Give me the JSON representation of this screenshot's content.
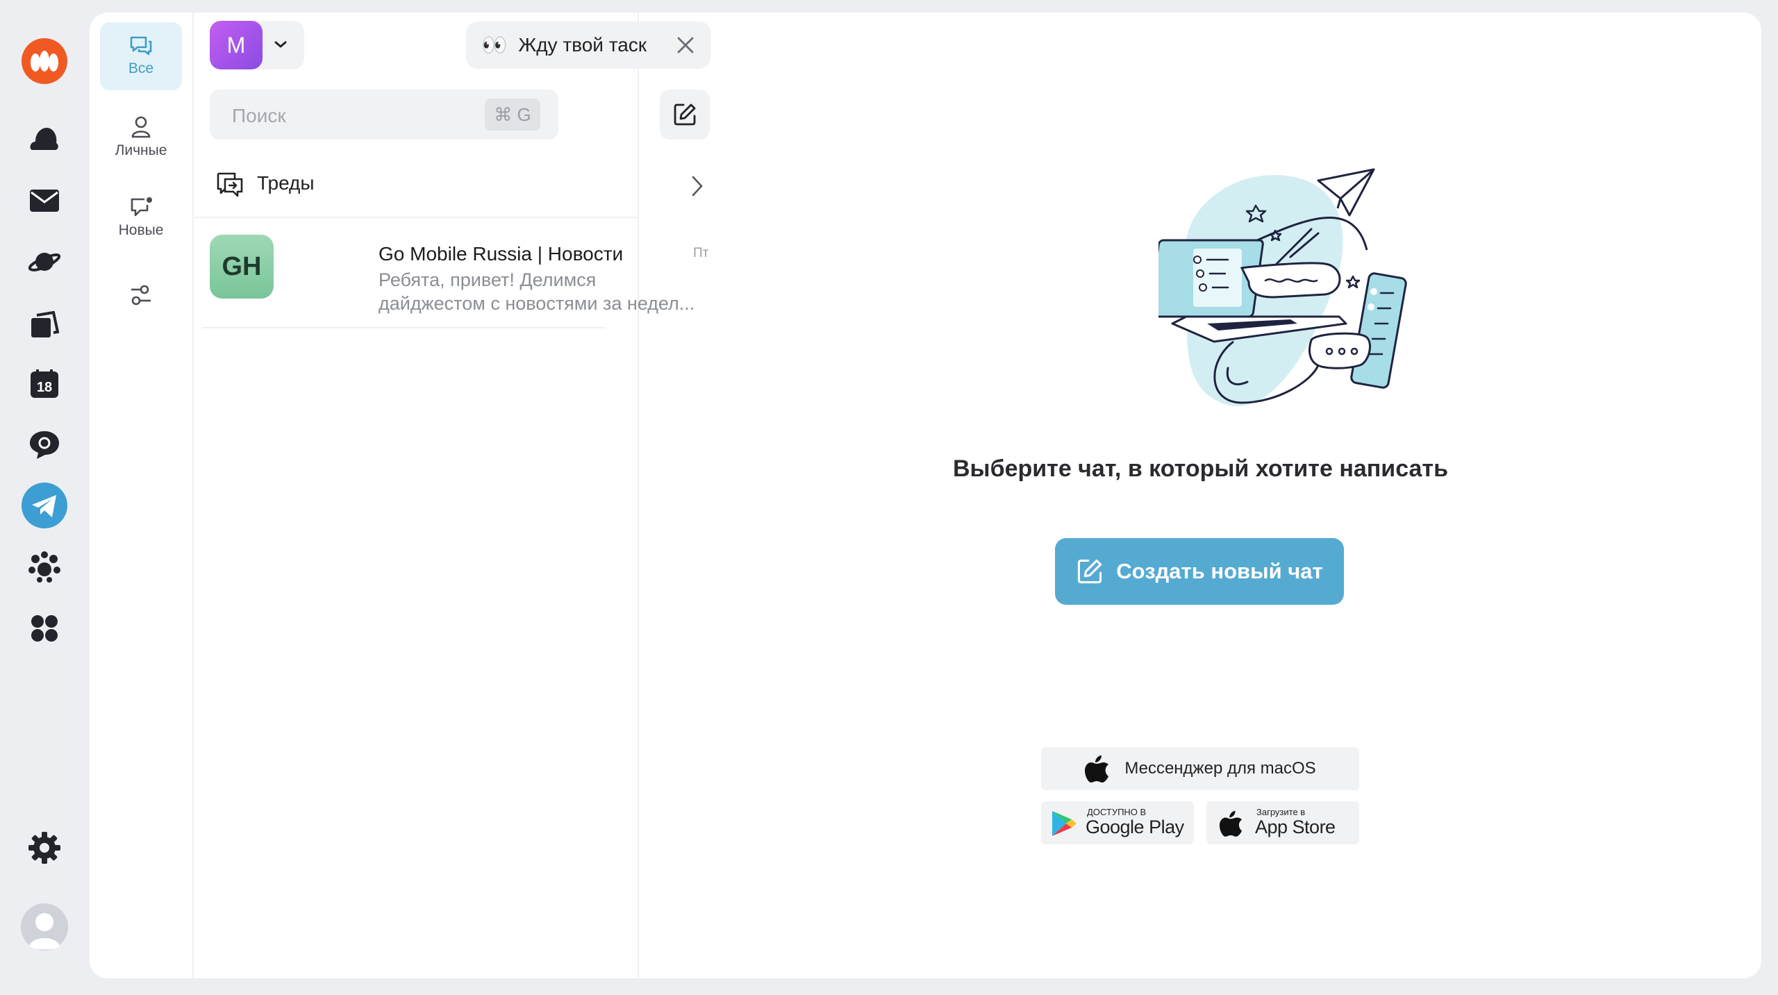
{
  "rail": {
    "items": [
      {
        "name": "messenger-logo-icon"
      },
      {
        "name": "cloud-icon"
      },
      {
        "name": "mail-icon"
      },
      {
        "name": "saturn-icon"
      },
      {
        "name": "cards-icon"
      },
      {
        "name": "calendar-icon",
        "text": "18"
      },
      {
        "name": "chat-bubble-icon"
      },
      {
        "name": "telegram-icon"
      },
      {
        "name": "pets-icon"
      },
      {
        "name": "apps-grid-icon"
      },
      {
        "name": "settings-gear-icon"
      },
      {
        "name": "user-avatar-icon"
      }
    ]
  },
  "filters": {
    "all": "Все",
    "personal": "Личные",
    "new": "Новые"
  },
  "account": {
    "initial": "M"
  },
  "status": {
    "emoji": "👀",
    "text": "Жду твой таск"
  },
  "search": {
    "placeholder": "Поиск",
    "shortcut": "⌘ G"
  },
  "threads": {
    "label": "Треды"
  },
  "chats": [
    {
      "avatar": "GH",
      "name": "Go Mobile Russia | Новости",
      "time": "Пт",
      "preview_line1": "Ребята, привет! Делимся",
      "preview_line2": "дайджестом с новостями за недел..."
    }
  ],
  "main": {
    "headline": "Выберите чат, в который хотите написать",
    "cta": "Создать новый чат",
    "store_macos": "Мессенджер для macOS",
    "google_small": "ДОСТУПНО В",
    "google_big": "Google Play",
    "apple_small": "Загрузите в",
    "apple_big": "App Store"
  },
  "colors": {
    "accent": "#55aad2",
    "active_filter_bg": "#e3f2f8",
    "avatar_m": "#a755ea",
    "avatar_gh": "#8fd0aa",
    "logo_orange": "#f05a22",
    "telegram_blue": "#3d9ed4"
  }
}
